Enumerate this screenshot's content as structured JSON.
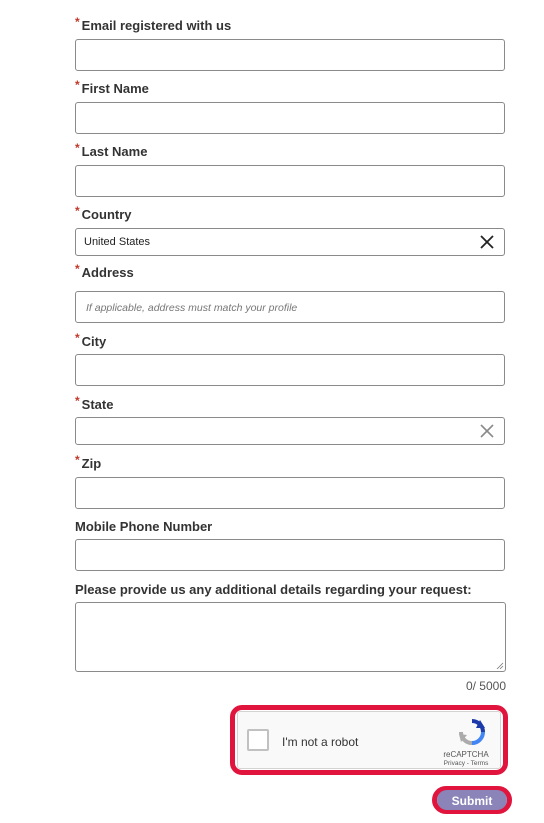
{
  "form": {
    "required_marker": "*",
    "fields": {
      "email": {
        "label": "Email registered with us",
        "value": ""
      },
      "first_name": {
        "label": "First Name",
        "value": ""
      },
      "last_name": {
        "label": "Last Name",
        "value": ""
      },
      "country": {
        "label": "Country",
        "value": "United States"
      },
      "address": {
        "label": "Address",
        "placeholder": "If applicable, address must match your profile"
      },
      "city": {
        "label": "City",
        "value": ""
      },
      "state": {
        "label": "State",
        "value": ""
      },
      "zip": {
        "label": "Zip",
        "value": ""
      },
      "mobile": {
        "label": "Mobile Phone Number",
        "value": ""
      },
      "details": {
        "label": "Please provide us any additional details regarding your request:",
        "value": "",
        "char_count": "0/ 5000"
      }
    },
    "captcha": {
      "label": "I'm not a robot",
      "brand": "reCAPTCHA",
      "links": "Privacy - Terms"
    },
    "submit_label": "Submit"
  },
  "colors": {
    "required": "#c0392b",
    "highlight": "#e0143c",
    "submit_bg": "#8a84b8"
  }
}
